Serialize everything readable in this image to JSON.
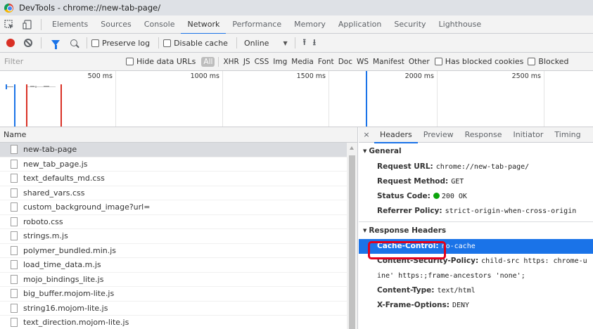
{
  "window": {
    "title": "DevTools - chrome://new-tab-page/"
  },
  "panels": [
    "Elements",
    "Sources",
    "Console",
    "Network",
    "Performance",
    "Memory",
    "Application",
    "Security",
    "Lighthouse"
  ],
  "active_panel": "Network",
  "toolbar": {
    "preserve_log": "Preserve log",
    "disable_cache": "Disable cache",
    "throttling": "Online"
  },
  "filterbar": {
    "placeholder": "Filter",
    "hide_data_urls": "Hide data URLs",
    "types": [
      "All",
      "XHR",
      "JS",
      "CSS",
      "Img",
      "Media",
      "Font",
      "Doc",
      "WS",
      "Manifest",
      "Other"
    ],
    "has_blocked_cookies": "Has blocked cookies",
    "blocked_requests": "Blocked"
  },
  "overview": {
    "ticks": [
      "500 ms",
      "1000 ms",
      "1500 ms",
      "2000 ms",
      "2500 ms"
    ]
  },
  "requests": {
    "header": "Name",
    "items": [
      "new-tab-page",
      "new_tab_page.js",
      "text_defaults_md.css",
      "shared_vars.css",
      "custom_background_image?url=",
      "roboto.css",
      "strings.m.js",
      "polymer_bundled.min.js",
      "load_time_data.m.js",
      "mojo_bindings_lite.js",
      "big_buffer.mojom-lite.js",
      "string16.mojom-lite.js",
      "text_direction.mojom-lite.js"
    ]
  },
  "details": {
    "close": "×",
    "tabs": [
      "Headers",
      "Preview",
      "Response",
      "Initiator",
      "Timing"
    ],
    "general": {
      "title": "General",
      "request_url_key": "Request URL:",
      "request_url": "chrome://new-tab-page/",
      "request_method_key": "Request Method:",
      "request_method": "GET",
      "status_code_key": "Status Code:",
      "status_code": "200 OK",
      "referrer_policy_key": "Referrer Policy:",
      "referrer_policy": "strict-origin-when-cross-origin"
    },
    "response_headers": {
      "title": "Response Headers",
      "cache_control_key": "Cache-Control:",
      "cache_control": "no-cache",
      "csp_key": "Content-Security-Policy:",
      "csp_line1": "child-src https:  chrome-u",
      "csp_line2": "ine' https:;frame-ancestors 'none';",
      "content_type_key": "Content-Type:",
      "content_type": "text/html",
      "x_frame_key": "X-Frame-Options:",
      "x_frame": "DENY"
    }
  }
}
